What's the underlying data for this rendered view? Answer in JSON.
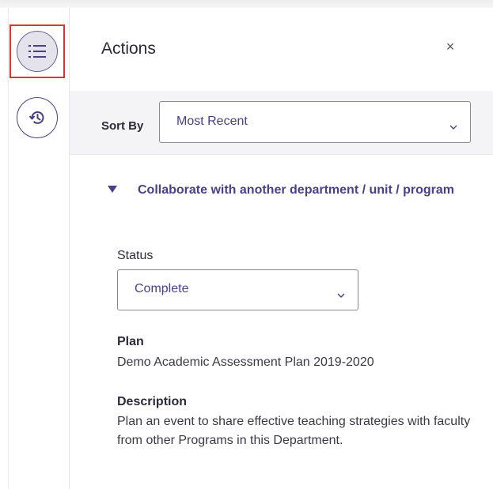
{
  "rail": {
    "items": [
      {
        "icon": "list-icon",
        "active": true
      },
      {
        "icon": "history-icon",
        "active": false
      }
    ]
  },
  "panel": {
    "title": "Actions",
    "close_glyph": "×"
  },
  "sort": {
    "label": "Sort By",
    "selected": "Most Recent"
  },
  "action": {
    "title": "Collaborate with another department / unit / program",
    "expanded": true,
    "status_label": "Status",
    "status_value": "Complete",
    "plan_label": "Plan",
    "plan_value": "Demo Academic Assessment Plan 2019-2020",
    "description_label": "Description",
    "description_value": "Plan an event to share effective teaching strategies with faculty from other Programs in this Department."
  },
  "colors": {
    "accent": "#4a3f8a",
    "highlight": "#e0352b",
    "sort_bar_bg": "#f4f4f6"
  }
}
